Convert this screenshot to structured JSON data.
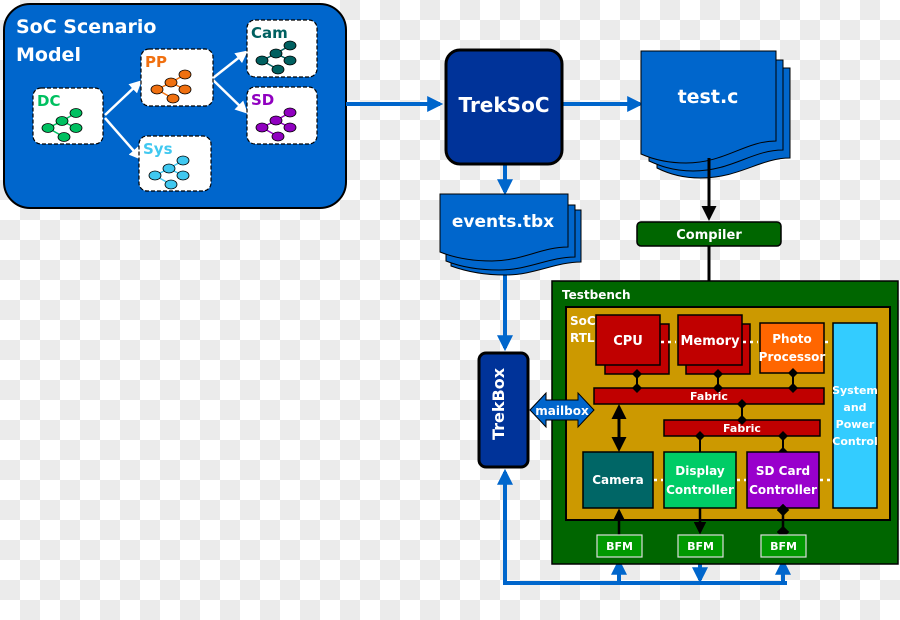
{
  "scenario_model": {
    "title_line1": "SoC Scenario",
    "title_line2": "Model",
    "nodes": [
      {
        "label": "DC",
        "color": "#00c060"
      },
      {
        "label": "PP",
        "color": "#f07010"
      },
      {
        "label": "Sys",
        "color": "#40c8f0"
      },
      {
        "label": "Cam",
        "color": "#006060"
      },
      {
        "label": "SD",
        "color": "#9000c0"
      }
    ]
  },
  "trek_soc": {
    "label": "TrekSoC"
  },
  "test_c": {
    "label": "test.c"
  },
  "events_tbx": {
    "label": "events.tbx"
  },
  "compiler": {
    "label": "Compiler"
  },
  "trekbox": {
    "label": "TrekBox"
  },
  "mailbox": {
    "label": "mailbox"
  },
  "testbench": {
    "label": "Testbench",
    "soc_rtl": {
      "label_line1": "SoC",
      "label_line2": "RTL",
      "cpu": "CPU",
      "memory": "Memory",
      "photo_processor_line1": "Photo",
      "photo_processor_line2": "Processor",
      "fabric_top": "Fabric",
      "fabric_bottom": "Fabric",
      "camera": "Camera",
      "display_controller_line1": "Display",
      "display_controller_line2": "Controller",
      "sd_card_controller_line1": "SD Card",
      "sd_card_controller_line2": "Controller",
      "system_power_line1": "System",
      "system_power_line2": "and",
      "system_power_line3": "Power",
      "system_power_line4": "Control"
    },
    "bfms": [
      "BFM",
      "BFM",
      "BFM"
    ]
  },
  "colors": {
    "flow_blue": "#0066cc",
    "dark_blue": "#003399",
    "testbench_green": "#006600",
    "soc_gold": "#cc9900",
    "red": "#c00000",
    "orange": "#ff6600",
    "teal": "#006666",
    "green": "#00cc66",
    "purple": "#9900cc",
    "cyan": "#33ccff",
    "bfm_green": "#009900"
  }
}
